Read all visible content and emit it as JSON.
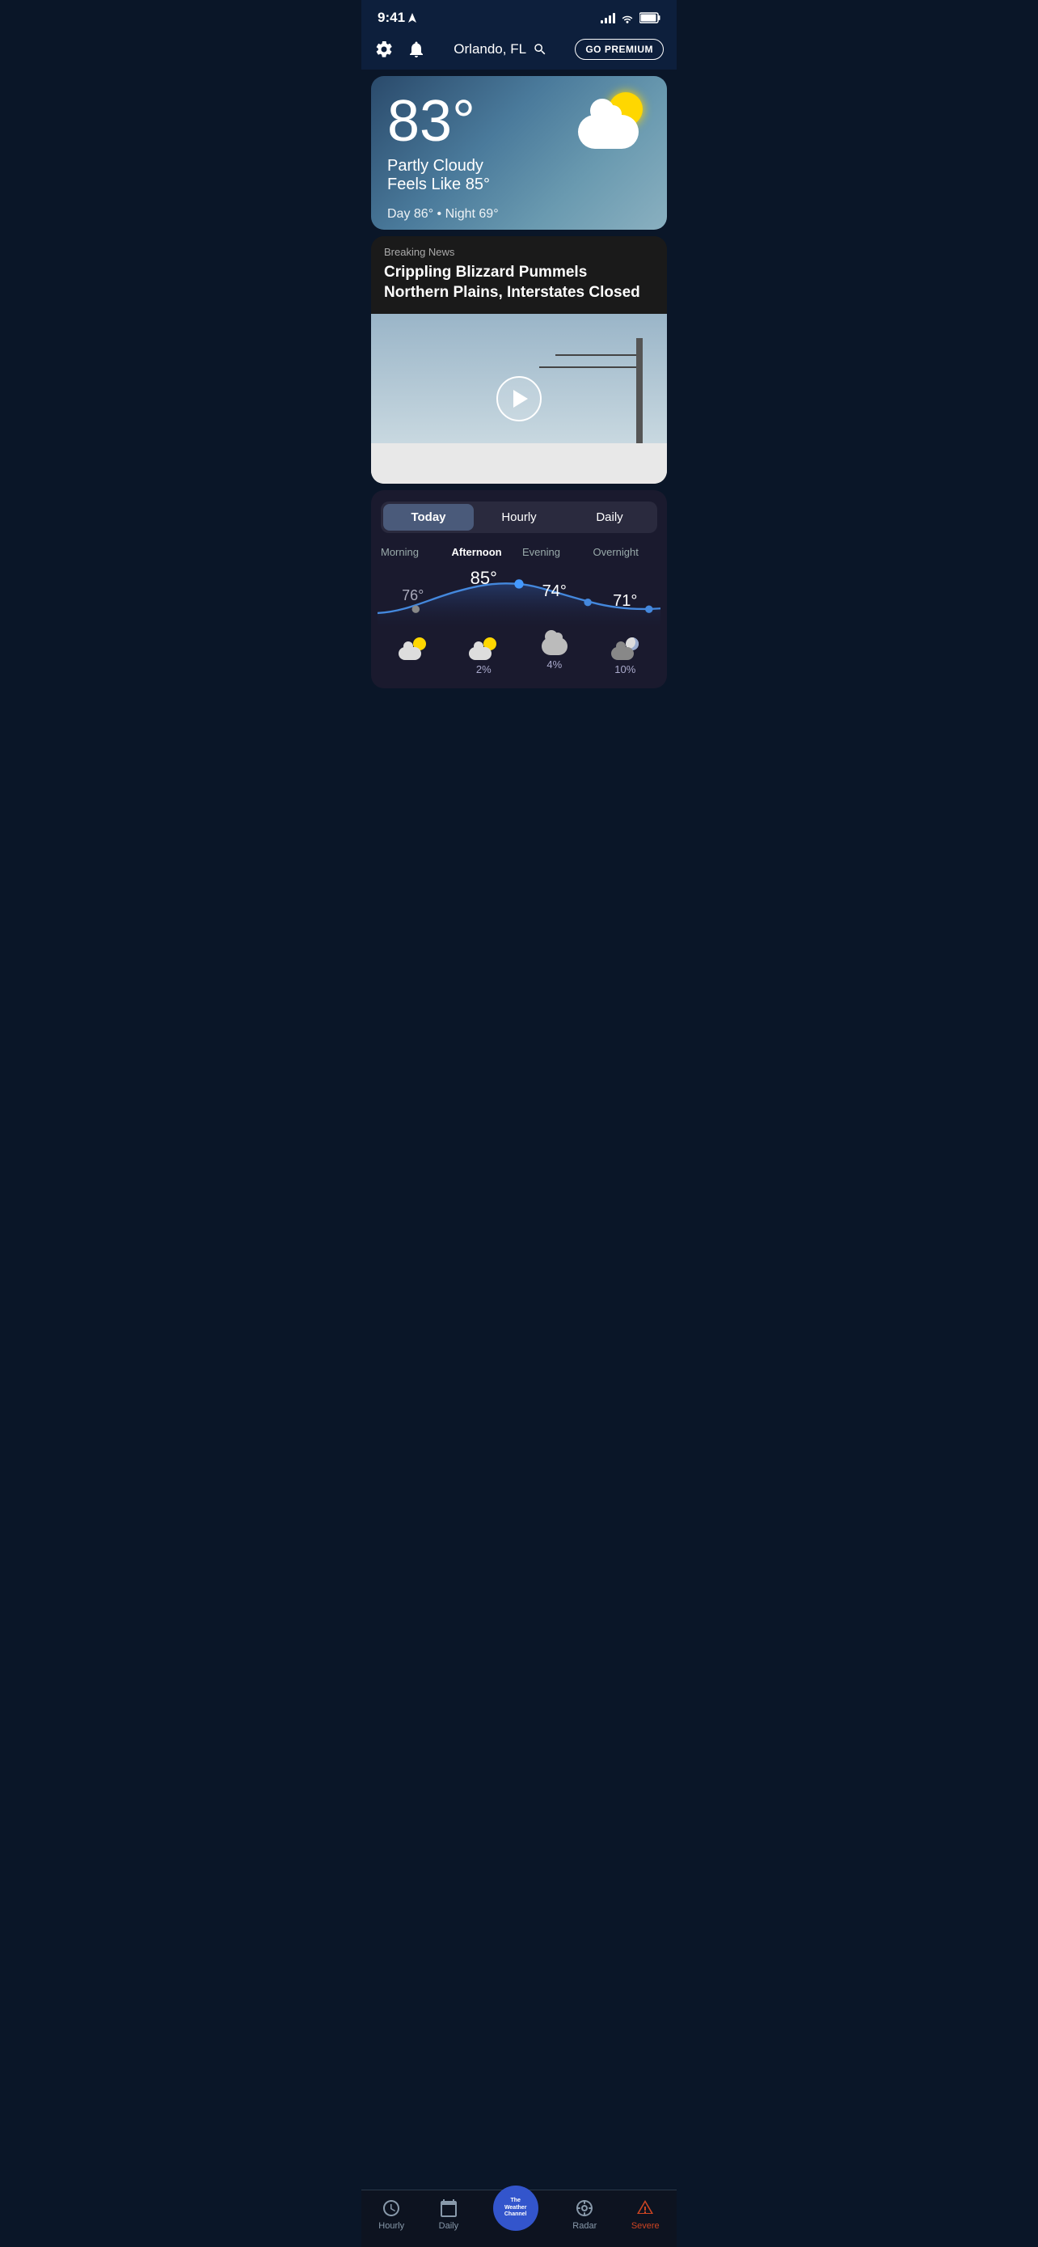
{
  "statusBar": {
    "time": "9:41",
    "locationArrow": "▶",
    "signalBars": 4,
    "wifi": true,
    "battery": "full"
  },
  "header": {
    "location": "Orlando, FL",
    "searchIcon": "search",
    "goPremium": "GO PREMIUM",
    "settingsIcon": "gear",
    "bellIcon": "bell"
  },
  "currentWeather": {
    "temperature": "83°",
    "condition": "Partly Cloudy",
    "feelsLike": "Feels Like 85°",
    "dayTemp": "Day 86°",
    "nightTemp": "Night 69°",
    "dayNightDot": "•"
  },
  "breakingNews": {
    "label": "Breaking News",
    "title": "Crippling Blizzard Pummels Northern Plains, Interstates Closed",
    "hasVideo": true,
    "playIcon": "play"
  },
  "forecast": {
    "tabs": [
      "Today",
      "Hourly",
      "Daily"
    ],
    "activeTab": 0,
    "timeOfDay": [
      {
        "label": "Morning",
        "temp": "76°",
        "icon": "partly-sunny",
        "precip": null,
        "active": false
      },
      {
        "label": "Afternoon",
        "temp": "85°",
        "icon": "partly-sunny",
        "precip": "2%",
        "active": true
      },
      {
        "label": "Evening",
        "temp": "74°",
        "icon": "cloudy",
        "precip": "4%",
        "active": false
      },
      {
        "label": "Overnight",
        "temp": "71°",
        "icon": "moon-cloud",
        "precip": "10%",
        "active": false
      }
    ]
  },
  "bottomNav": {
    "items": [
      {
        "label": "Hourly",
        "icon": "clock"
      },
      {
        "label": "Daily",
        "icon": "calendar"
      },
      {
        "label": "The\nWeather\nChannel",
        "icon": "twc",
        "isCenter": true
      },
      {
        "label": "Radar",
        "icon": "radar"
      },
      {
        "label": "Severe",
        "icon": "severe",
        "isRed": true
      }
    ]
  }
}
